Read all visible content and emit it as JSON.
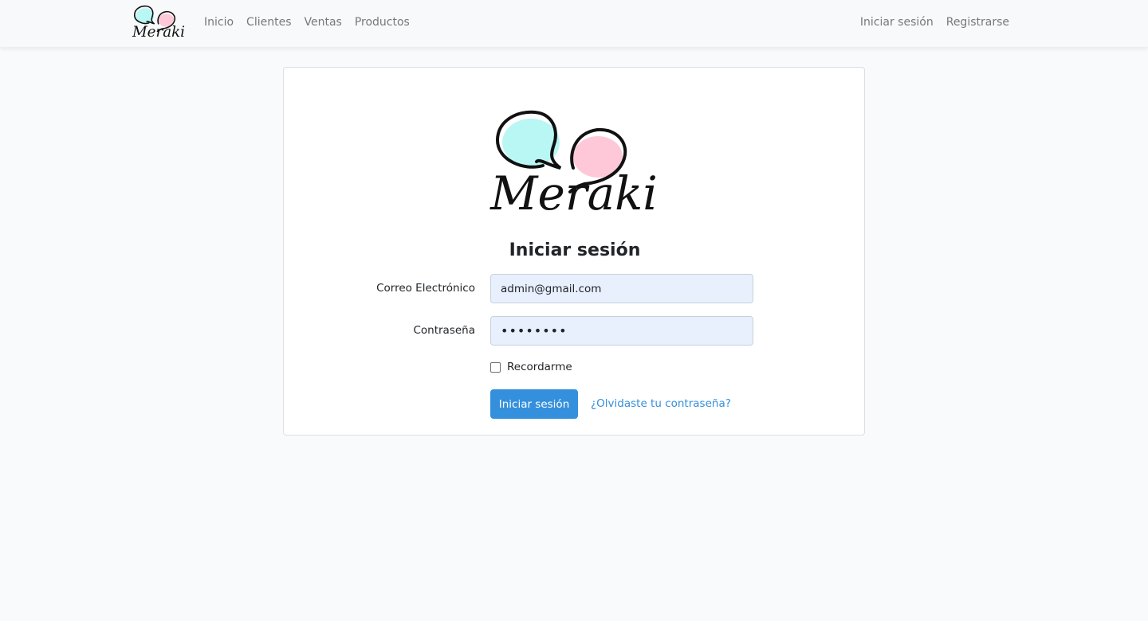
{
  "brand": {
    "logo_text": "Meraki",
    "colors": {
      "bubble_left": "#b9f7f5",
      "bubble_right": "#ffc8d8",
      "ink": "#111111"
    }
  },
  "navbar": {
    "links": [
      "Inicio",
      "Clientes",
      "Ventas",
      "Productos"
    ],
    "right_links": [
      "Iniciar sesión",
      "Registrarse"
    ]
  },
  "login": {
    "title": "Iniciar sesión",
    "email_label": "Correo Electrónico",
    "email_value": "admin@gmail.com",
    "password_label": "Contraseña",
    "password_masked": "••••••••",
    "remember_label": "Recordarme",
    "remember_checked": false,
    "submit_label": "Iniciar sesión",
    "forgot_label": "¿Olvidaste tu contraseña?"
  },
  "colors": {
    "primary": "#3490dc",
    "input_autofill_bg": "#e8f0fe",
    "navbar_bg": "#f8f9fa",
    "page_bg": "#f8fafc"
  }
}
